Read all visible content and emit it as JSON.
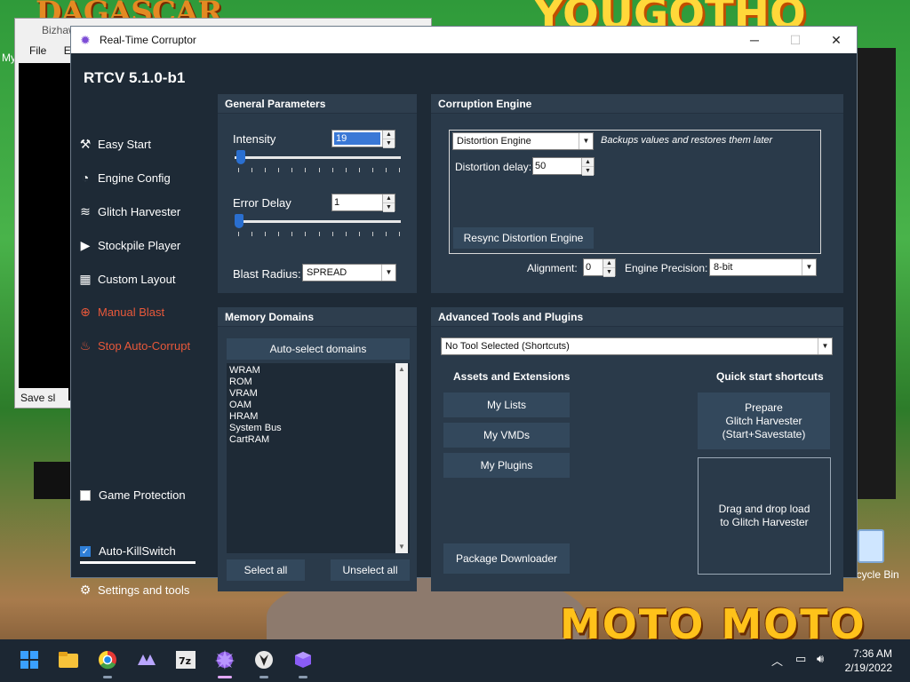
{
  "desktop": {
    "bg_title_left": "DAGASCAR",
    "bg_title_right": "YOUGOTHO",
    "bottom_title": "MOTO MOTO",
    "recycle_bin_label": "Recycle Bin",
    "left_tag": "My"
  },
  "background_window": {
    "title": "Bizhaw",
    "menu": [
      "File",
      "Em"
    ],
    "status": "Save sl"
  },
  "window": {
    "title": "Real-Time Corruptor",
    "icon": "rtc-icon",
    "minimize": "─",
    "maximize": "☐",
    "close": "✕"
  },
  "sidebar": {
    "brand": "RTCV 5.1.0-b1",
    "items": [
      {
        "label": "Easy Start",
        "icon": "wand-icon"
      },
      {
        "label": "Engine Config",
        "icon": "gauge-icon"
      },
      {
        "label": "Glitch Harvester",
        "icon": "layers-icon"
      },
      {
        "label": "Stockpile Player",
        "icon": "play-icon"
      },
      {
        "label": "Custom Layout",
        "icon": "grid-icon"
      },
      {
        "label": "Manual Blast",
        "icon": "crosshair-icon"
      },
      {
        "label": "Stop Auto-Corrupt",
        "icon": "flame-icon"
      }
    ],
    "game_protection": {
      "label": "Game Protection",
      "checked": false
    },
    "auto_killswitch": {
      "label": "Auto-KillSwitch",
      "checked": true
    },
    "settings": {
      "label": "Settings and tools",
      "icon": "gear-icon"
    }
  },
  "general_parameters": {
    "title": "General Parameters",
    "intensity_label": "Intensity",
    "intensity_value": "19",
    "intensity_fraction": 0.01,
    "error_delay_label": "Error Delay",
    "error_delay_value": "1",
    "error_delay_fraction": 0.0,
    "blast_radius_label": "Blast Radius:",
    "blast_radius_value": "SPREAD"
  },
  "corruption_engine": {
    "title": "Corruption Engine",
    "engine": "Distortion Engine",
    "engine_desc": "Backups values and restores them later",
    "distortion_delay_label": "Distortion delay:",
    "distortion_delay_value": "50",
    "resync_button": "Resync Distortion Engine",
    "alignment_label": "Alignment:",
    "alignment_value": "0",
    "precision_label": "Engine Precision:",
    "precision_value": "8-bit"
  },
  "memory_domains": {
    "title": "Memory Domains",
    "auto_select": "Auto-select domains",
    "domains": [
      "WRAM",
      "ROM",
      "VRAM",
      "OAM",
      "HRAM",
      "System Bus",
      "CartRAM"
    ],
    "select_all": "Select all",
    "unselect_all": "Unselect all"
  },
  "advanced_tools": {
    "title": "Advanced Tools and Plugins",
    "tool_select": "No Tool Selected (Shortcuts)",
    "assets_title": "Assets and Extensions",
    "quick_title": "Quick start shortcuts",
    "my_lists": "My Lists",
    "my_vmds": "My VMDs",
    "my_plugins": "My Plugins",
    "package_downloader": "Package Downloader",
    "prepare_gh_1": "Prepare",
    "prepare_gh_2": "Glitch Harvester",
    "prepare_gh_3": "(Start+Savestate)",
    "drop_1": "Drag and drop load",
    "drop_2": "to Glitch Harvester"
  },
  "taskbar": {
    "apps": [
      "start-icon",
      "file-explorer-icon",
      "chrome-icon",
      "vmd-app-icon",
      "7zip-icon",
      "rtcv-icon",
      "bizhawk-icon",
      "cube-app-icon"
    ],
    "time": "7:36 AM",
    "date": "2/19/2022"
  }
}
